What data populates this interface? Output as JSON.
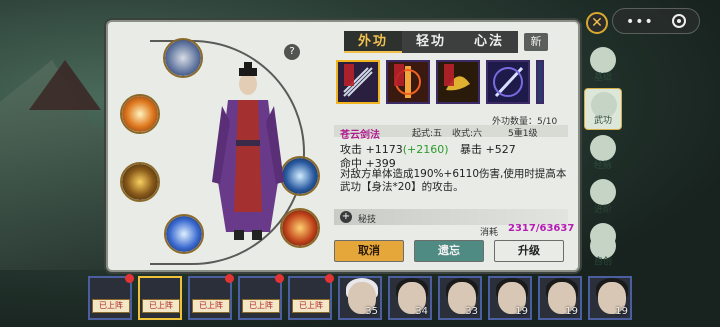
{
  "tabs": [
    "外功",
    "轻功",
    "心法"
  ],
  "tab_new": "新",
  "help": "?",
  "skill_count": "外功数量：5/10",
  "skill": {
    "name": "苍云剑法",
    "start": "起式:五",
    "end": "收式:六",
    "level": "5重1级"
  },
  "stats": {
    "attack": "攻击 +1173",
    "attack_bonus": "(+2160)",
    "crit": "暴击 +527",
    "hit": "命中 +399"
  },
  "description": "对敌方单体造成190%+6110伤害,使用时提高本武功【身法*20】的攻击。",
  "secret": "秘技",
  "cost_label": "消耗",
  "cost_value": "2317/63637",
  "buttons": {
    "cancel": "取消",
    "forget": "遗忘",
    "upgrade": "升级"
  },
  "sidebar": [
    "基础",
    "武功",
    "经脉",
    "进阶",
    "丹药",
    "自创"
  ],
  "roster": {
    "badge": "已上阵",
    "levels": [
      "35",
      "34",
      "33",
      "19",
      "19",
      "19"
    ]
  },
  "colors": {
    "accent": "#f2c14d",
    "skill_name": "#b01c8e",
    "cost": "#b61bb6",
    "bonus": "#2a9a2a"
  }
}
